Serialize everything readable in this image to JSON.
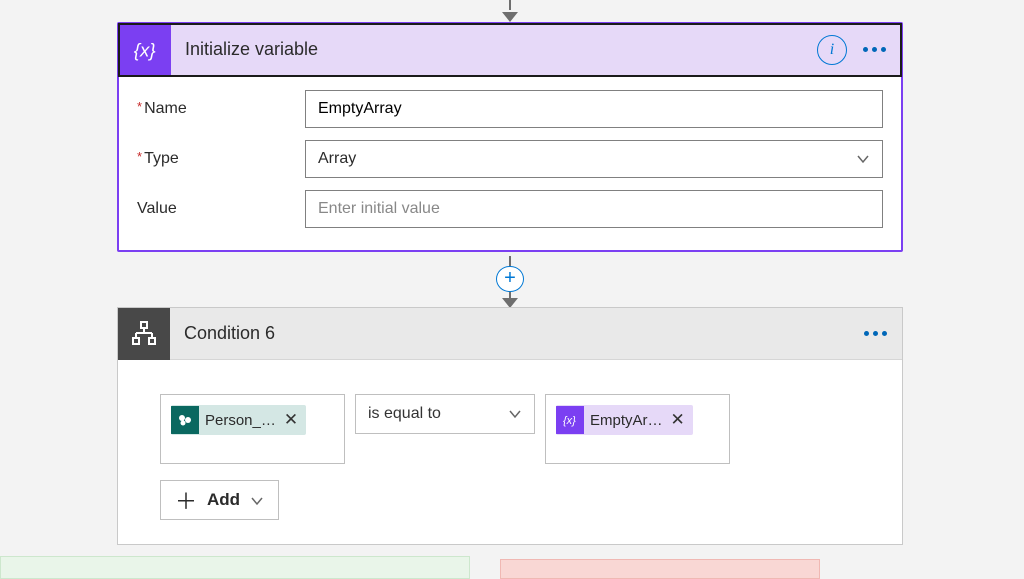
{
  "init_card": {
    "title": "Initialize variable",
    "fields": {
      "name_label": "Name",
      "name_value": "EmptyArray",
      "type_label": "Type",
      "type_value": "Array",
      "value_label": "Value",
      "value_placeholder": "Enter initial value"
    }
  },
  "condition_card": {
    "title": "Condition 6",
    "left_token": {
      "label": "Person_…"
    },
    "operator": "is equal to",
    "right_token": {
      "label": "EmptyAr…"
    },
    "add_label": "Add"
  }
}
